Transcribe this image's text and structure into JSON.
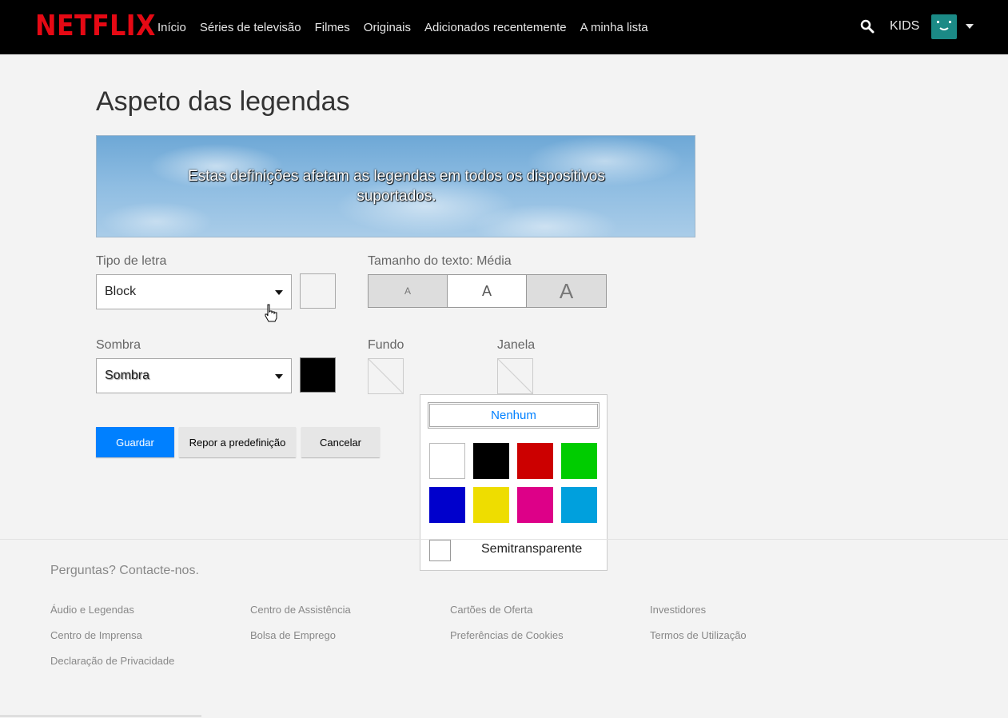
{
  "header": {
    "logo": "NETFLIX",
    "nav": [
      "Início",
      "Séries de televisão",
      "Filmes",
      "Originais",
      "Adicionados recentemente",
      "A minha lista"
    ],
    "kids": "KIDS"
  },
  "main": {
    "title": "Aspeto das legendas",
    "banner_text": "Estas definições afetam as legendas em todos os dispositivos suportados.",
    "font_label": "Tipo de letra",
    "font_value": "Block",
    "font_color": "#ffffff",
    "size_label": "Tamanho do texto: Média",
    "size_options": [
      "A",
      "A",
      "A"
    ],
    "shadow_label": "Sombra",
    "shadow_value": "Sombra",
    "shadow_color": "#000000",
    "background_label": "Fundo",
    "window_label": "Janela"
  },
  "buttons": {
    "save": "Guardar",
    "reset": "Repor a predefinição",
    "cancel": "Cancelar"
  },
  "popup": {
    "none_label": "Nenhum",
    "colors": [
      "#ffffff",
      "#000000",
      "#cc0000",
      "#00cc00",
      "#0000cc",
      "#eedd00",
      "#dd0088",
      "#00a0dd"
    ],
    "semi_label": "Semitransparente"
  },
  "footer": {
    "contact": "Perguntas? Contacte-nos.",
    "links": [
      "Áudio e Legendas",
      "Centro de Assistência",
      "Cartões de Oferta",
      "Investidores",
      "Centro de Imprensa",
      "Bolsa de Emprego",
      "Preferências de Cookies",
      "Termos de Utilização",
      "Declaração de Privacidade"
    ]
  }
}
